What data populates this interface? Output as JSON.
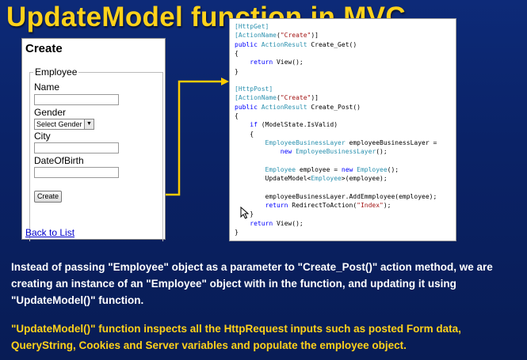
{
  "slide_title": "UpdateModel function in MVC",
  "form": {
    "heading": "Create",
    "legend": "Employee",
    "fields": {
      "name_label": "Name",
      "gender_label": "Gender",
      "gender_select_value": "Select Gender",
      "city_label": "City",
      "dob_label": "DateOfBirth"
    },
    "create_button": "Create",
    "back_link": "Back to List"
  },
  "code": {
    "lines": [
      [
        {
          "t": "[HttpGet]",
          "c": "attr"
        }
      ],
      [
        {
          "t": "[",
          "c": "attr"
        },
        {
          "t": "ActionName",
          "c": "ty"
        },
        {
          "t": "(",
          "c": ""
        },
        {
          "t": "\"Create\"",
          "c": "str"
        },
        {
          "t": ")]",
          "c": ""
        }
      ],
      [
        {
          "t": "public ",
          "c": "kw"
        },
        {
          "t": "ActionResult ",
          "c": "ty"
        },
        {
          "t": "Create_Get()",
          "c": ""
        }
      ],
      [
        {
          "t": "{",
          "c": ""
        }
      ],
      [
        {
          "t": "    return ",
          "c": "kw"
        },
        {
          "t": "View();",
          "c": ""
        }
      ],
      [
        {
          "t": "}",
          "c": ""
        }
      ],
      [
        {
          "t": "",
          "c": ""
        }
      ],
      [
        {
          "t": "[HttpPost]",
          "c": "attr"
        }
      ],
      [
        {
          "t": "[",
          "c": "attr"
        },
        {
          "t": "ActionName",
          "c": "ty"
        },
        {
          "t": "(",
          "c": ""
        },
        {
          "t": "\"Create\"",
          "c": "str"
        },
        {
          "t": ")]",
          "c": ""
        }
      ],
      [
        {
          "t": "public ",
          "c": "kw"
        },
        {
          "t": "ActionResult ",
          "c": "ty"
        },
        {
          "t": "Create_Post()",
          "c": ""
        }
      ],
      [
        {
          "t": "{",
          "c": ""
        }
      ],
      [
        {
          "t": "    if ",
          "c": "kw"
        },
        {
          "t": "(ModelState.IsValid)",
          "c": ""
        }
      ],
      [
        {
          "t": "    {",
          "c": ""
        }
      ],
      [
        {
          "t": "        EmployeeBusinessLayer ",
          "c": "ty"
        },
        {
          "t": "employeeBusinessLayer =",
          "c": ""
        }
      ],
      [
        {
          "t": "            new ",
          "c": "kw"
        },
        {
          "t": "EmployeeBusinessLayer",
          "c": "ty"
        },
        {
          "t": "();",
          "c": ""
        }
      ],
      [
        {
          "t": "",
          "c": ""
        }
      ],
      [
        {
          "t": "        Employee ",
          "c": "ty"
        },
        {
          "t": "employee = ",
          "c": ""
        },
        {
          "t": "new ",
          "c": "kw"
        },
        {
          "t": "Employee",
          "c": "ty"
        },
        {
          "t": "();",
          "c": ""
        }
      ],
      [
        {
          "t": "        UpdateModel<",
          "c": ""
        },
        {
          "t": "Employee",
          "c": "ty"
        },
        {
          "t": ">(employee);",
          "c": ""
        }
      ],
      [
        {
          "t": "",
          "c": ""
        }
      ],
      [
        {
          "t": "        employeeBusinessLayer.AddEmmployee(employee);",
          "c": ""
        }
      ],
      [
        {
          "t": "        return ",
          "c": "kw"
        },
        {
          "t": "RedirectToAction(",
          "c": ""
        },
        {
          "t": "\"Index\"",
          "c": "str"
        },
        {
          "t": ");",
          "c": ""
        }
      ],
      [
        {
          "t": "    }",
          "c": ""
        }
      ],
      [
        {
          "t": "    return ",
          "c": "kw"
        },
        {
          "t": "View();",
          "c": ""
        }
      ],
      [
        {
          "t": "}",
          "c": ""
        }
      ]
    ]
  },
  "description": {
    "paragraph1": "Instead of passing \"Employee\" object as a parameter to \"Create_Post()\" action method, we are creating an instance of an \"Employee\" object with in the function, and updating it using \"UpdateModel()\" function.",
    "paragraph2": "\"UpdateModel()\" function inspects all the HttpRequest inputs such as posted Form data, QueryString, Cookies and Server variables and populate the employee object."
  },
  "colors": {
    "title": "#ffd21a",
    "arrow": "#ffcc00",
    "paragraph1": "#ffffff",
    "paragraph2": "#ffd21a"
  },
  "icons": {
    "pointer": "mouse-pointer-icon",
    "select_arrow": "dropdown-arrow-icon"
  }
}
